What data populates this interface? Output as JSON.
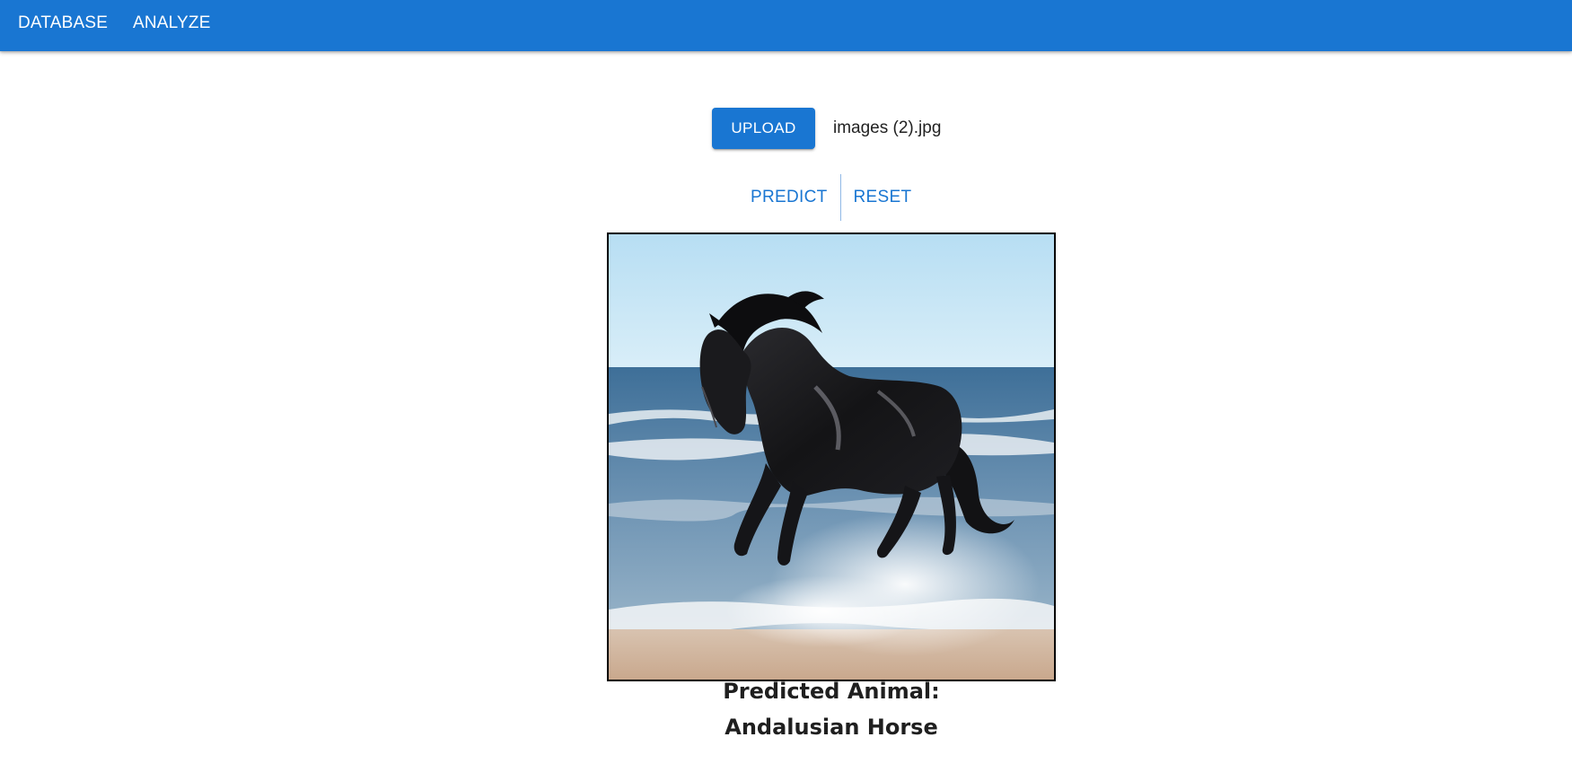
{
  "nav": {
    "items": [
      {
        "label": "DATABASE"
      },
      {
        "label": "ANALYZE"
      }
    ]
  },
  "upload": {
    "button_label": "UPLOAD",
    "file_name": "images (2).jpg"
  },
  "actions": {
    "predict_label": "PREDICT",
    "reset_label": "RESET"
  },
  "preview": {
    "subject": "horse-galloping-on-beach"
  },
  "result": {
    "title": "Predicted Animal:",
    "value": "Andalusian Horse"
  },
  "colors": {
    "primary": "#1976d2",
    "text": "#1f1f1f"
  }
}
